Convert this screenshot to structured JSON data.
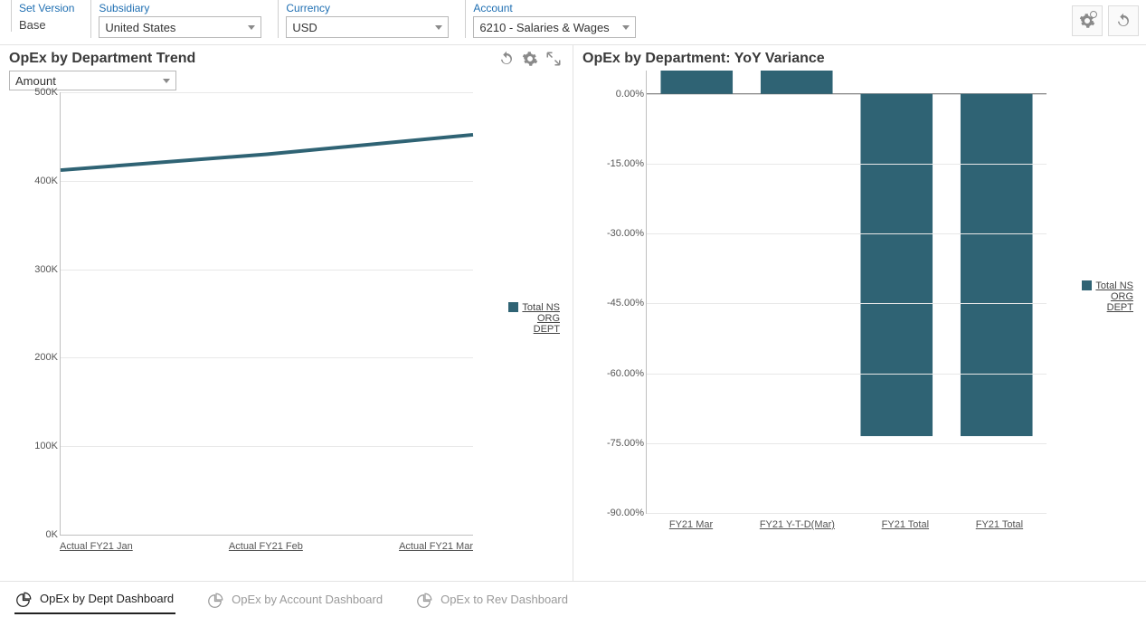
{
  "filters": {
    "version": {
      "label": "Set Version",
      "value": "Base"
    },
    "subsidiary": {
      "label": "Subsidiary",
      "value": "United States"
    },
    "currency": {
      "label": "Currency",
      "value": "USD"
    },
    "account": {
      "label": "Account",
      "value": "6210 - Salaries & Wages"
    }
  },
  "panel_left": {
    "title": "OpEx by Department Trend",
    "amount_select": "Amount"
  },
  "panel_right": {
    "title": "OpEx by Department: YoY Variance"
  },
  "legend": {
    "l1": "Total NS",
    "l2": "ORG",
    "l3": "DEPT"
  },
  "tabs": {
    "t1": "OpEx by Dept Dashboard",
    "t2": "OpEx by Account Dashboard",
    "t3": "OpEx to Rev Dashboard"
  },
  "chart_data": [
    {
      "type": "line",
      "title": "OpEx by Department Trend",
      "ylabel": "",
      "xlabel": "",
      "ylim": [
        0,
        500000
      ],
      "y_ticks": [
        "0K",
        "100K",
        "200K",
        "300K",
        "400K",
        "500K"
      ],
      "categories": [
        "Actual FY21 Jan",
        "Actual FY21 Feb",
        "Actual FY21 Mar"
      ],
      "series": [
        {
          "name": "Total NS ORG DEPT",
          "values": [
            412000,
            430000,
            452000
          ]
        }
      ]
    },
    {
      "type": "bar",
      "title": "OpEx by Department: YoY Variance",
      "ylabel": "",
      "xlabel": "",
      "ylim": [
        -90,
        5
      ],
      "y_ticks": [
        "0.00%",
        "-15.00%",
        "-30.00%",
        "-45.00%",
        "-60.00%",
        "-75.00%",
        "-90.00%"
      ],
      "categories": [
        "FY21 Mar",
        "FY21 Y-T-D(Mar)",
        "FY21 Total",
        "FY21 Total"
      ],
      "series": [
        {
          "name": "Total NS ORG DEPT",
          "values": [
            5.0,
            5.0,
            -73.5,
            -73.5
          ]
        }
      ]
    }
  ]
}
